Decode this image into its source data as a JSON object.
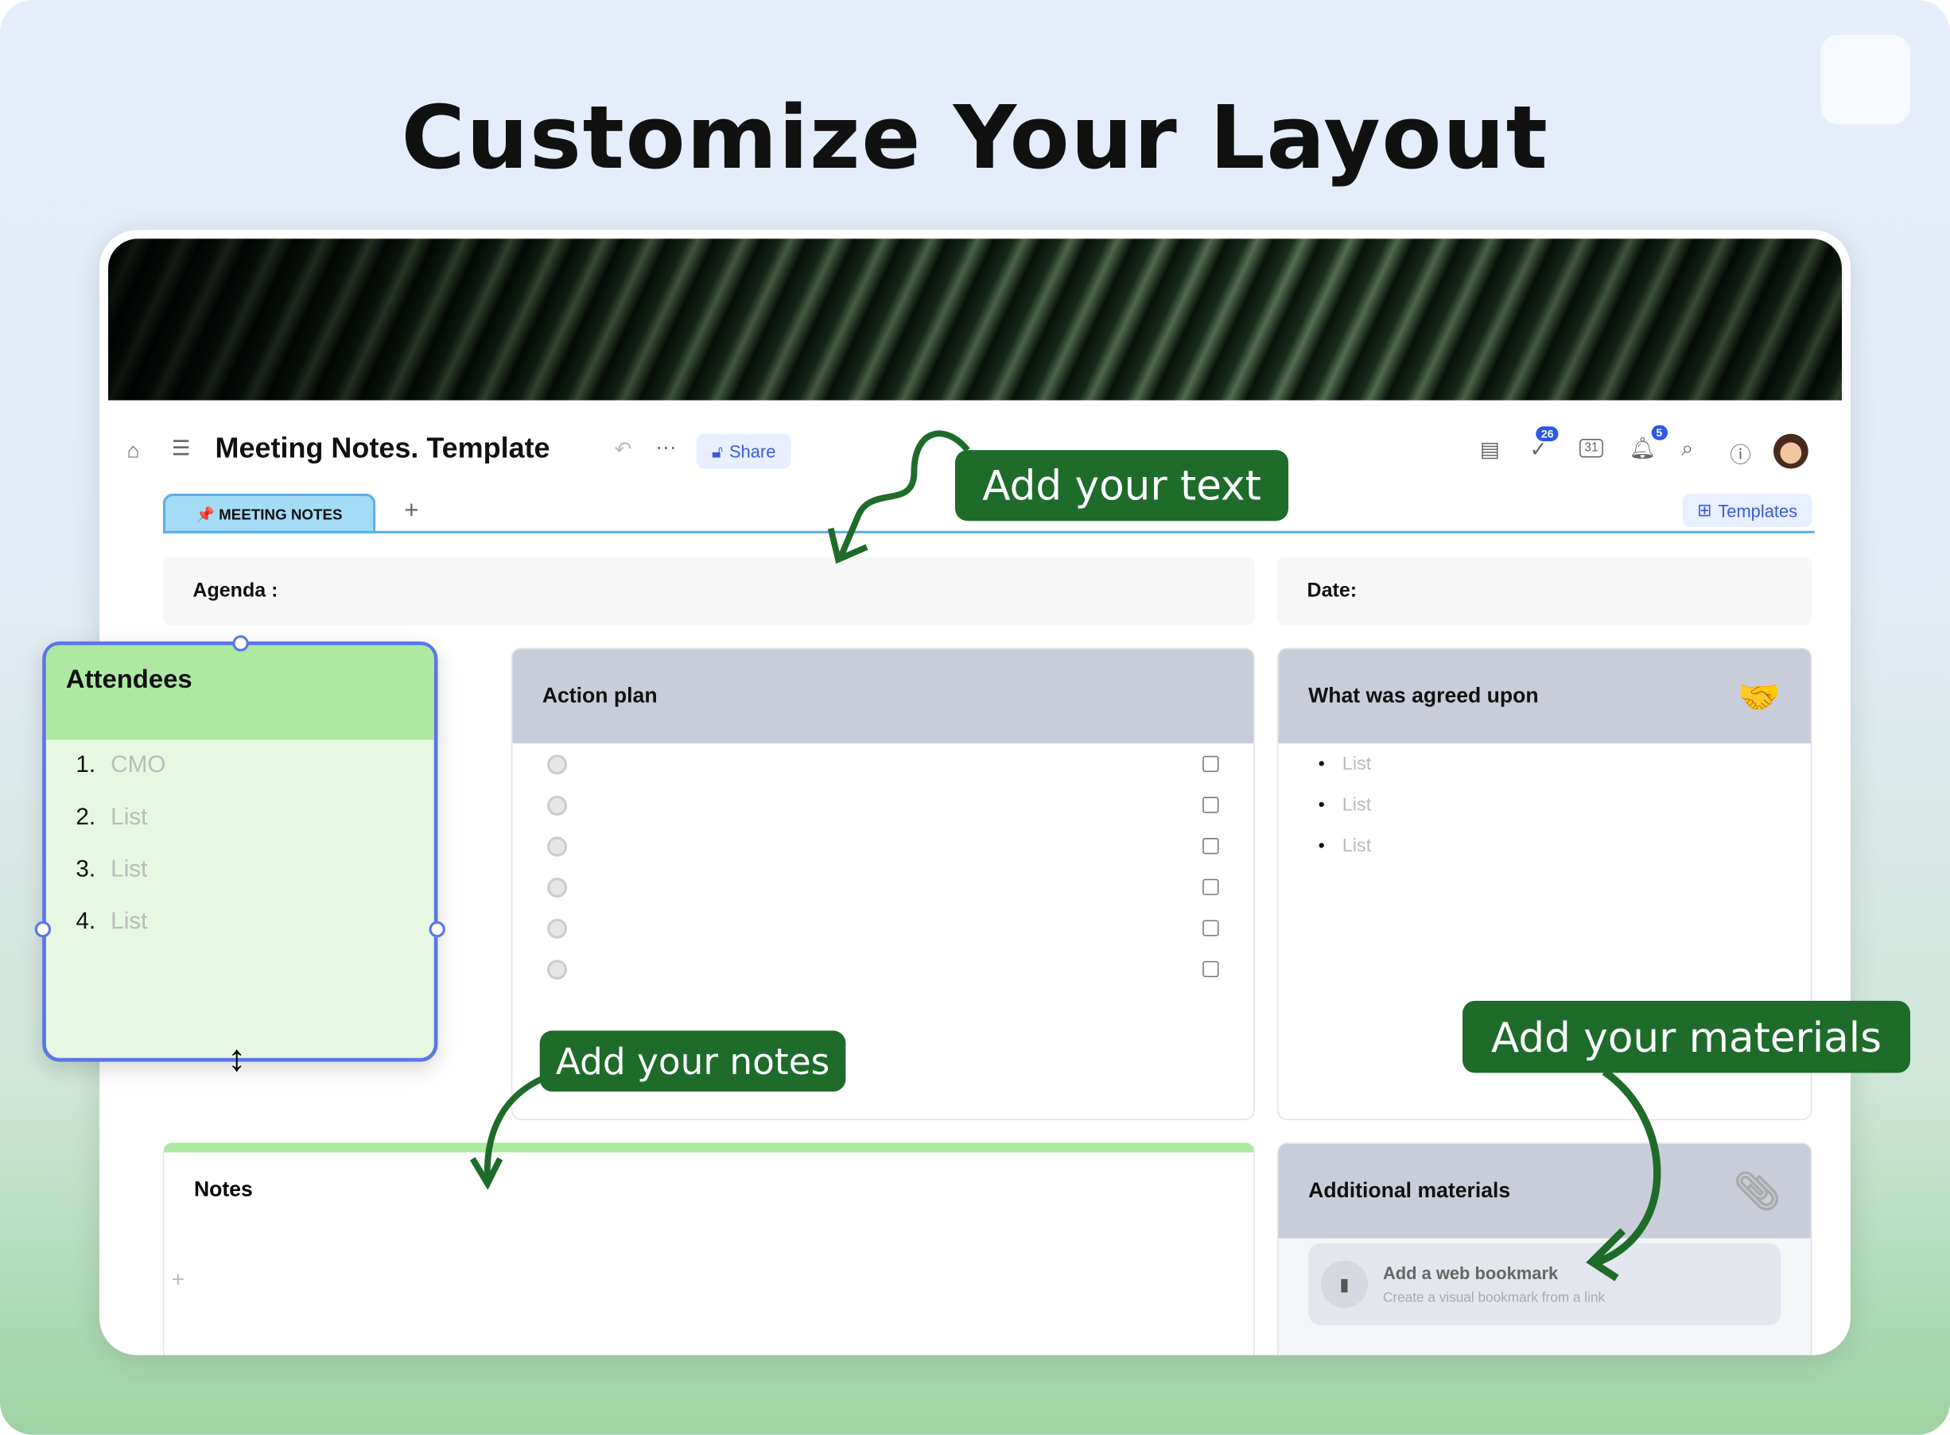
{
  "headline": "Customize Your Layout",
  "header": {
    "title": "Meeting Notes. Template",
    "share_label": "Share",
    "tasks_badge": "26",
    "notifications_badge": "5",
    "calendar_day": "31",
    "templates_label": "Templates"
  },
  "tabs": [
    {
      "label": "📌 MEETING NOTES"
    }
  ],
  "add_tab": "+",
  "agenda_label": "Agenda :",
  "date_label": "Date:",
  "attendees": {
    "title": "Attendees",
    "items": [
      {
        "n": "1.",
        "text": "CMO"
      },
      {
        "n": "2.",
        "text": "List"
      },
      {
        "n": "3.",
        "text": "List"
      },
      {
        "n": "4.",
        "text": "List"
      }
    ]
  },
  "action_plan": {
    "title": "Action plan",
    "rows": 6
  },
  "agreed": {
    "title": "What was agreed upon",
    "emoji": "🤝",
    "items": [
      "List",
      "List",
      "List"
    ]
  },
  "notes": {
    "title": "Notes",
    "add": "+"
  },
  "materials": {
    "title": "Additional materials",
    "bookmark_title": "Add a web bookmark",
    "bookmark_subtitle": "Create a visual bookmark from a link"
  },
  "callouts": {
    "text": "Add your text",
    "notes": "Add your notes",
    "materials": "Add your materials"
  },
  "colors": {
    "accent": "#3b5bdb",
    "callout": "#1e6b2a",
    "attendees_header": "#aee9a2",
    "tab": "#a4dcf6"
  }
}
